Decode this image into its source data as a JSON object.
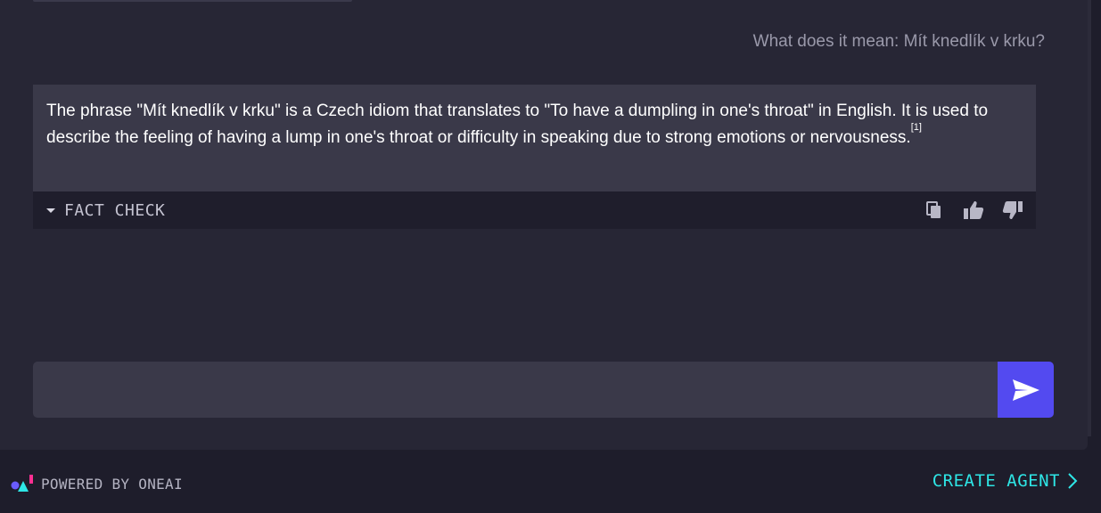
{
  "conversation": {
    "user_message": "What does it mean: Mít knedlík v krku?",
    "answer": {
      "text": "The phrase \"Mít knedlík v krku\" is a Czech idiom that translates to \"To have a dumpling in one's throat\" in English. It is used to describe the feeling of having a lump in one's throat or difficulty in speaking due to strong emotions or nervousness.",
      "citation": "[1]"
    },
    "fact_check_label": "FACT CHECK",
    "actions": [
      "copy-icon",
      "thumbs-up-icon",
      "thumbs-down-icon"
    ]
  },
  "composer": {
    "placeholder": "",
    "value": "",
    "send_icon": "send-icon"
  },
  "footer": {
    "powered_by": "POWERED BY ONEAI",
    "create_agent": "CREATE AGENT"
  },
  "colors": {
    "accent": "#534af0",
    "link": "#2ee6e6",
    "answer_bg": "#3a3949"
  }
}
